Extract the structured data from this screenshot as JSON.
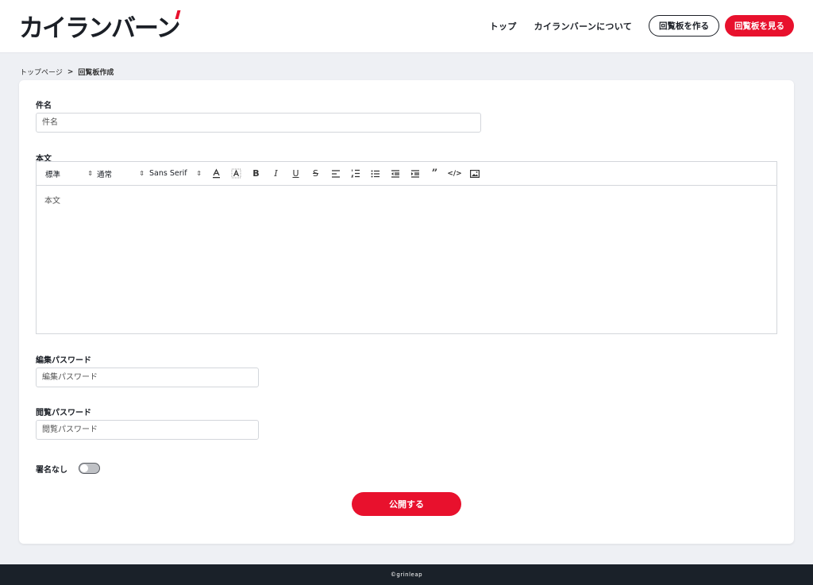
{
  "header": {
    "logo_main": "カイランバ",
    "logo_tail": "ーン",
    "nav_top": "トップ",
    "nav_about": "カイランバーンについて",
    "create_button": "回覧板を作る",
    "view_button": "回覧板を見る"
  },
  "breadcrumb": {
    "home": "トップページ",
    "separator": ">",
    "current": "回覧板作成"
  },
  "form": {
    "subject_label": "件名",
    "subject_placeholder": "件名",
    "body_label": "本文",
    "body_placeholder": "本文",
    "toolbar": {
      "heading_select": "標準",
      "size_select": "通常",
      "font_select": "Sans Serif"
    },
    "edit_password_label": "編集パスワード",
    "edit_password_placeholder": "編集パスワード",
    "view_password_label": "閲覧パスワード",
    "view_password_placeholder": "閲覧パスワード",
    "anonymous_label": "署名なし",
    "anonymous_enabled": false,
    "publish_button": "公開する"
  },
  "footer": {
    "copyright": "©grinleap"
  },
  "colors": {
    "accent": "#e8112d",
    "footer_bg": "#1a2129",
    "page_bg": "#eef0f4"
  }
}
